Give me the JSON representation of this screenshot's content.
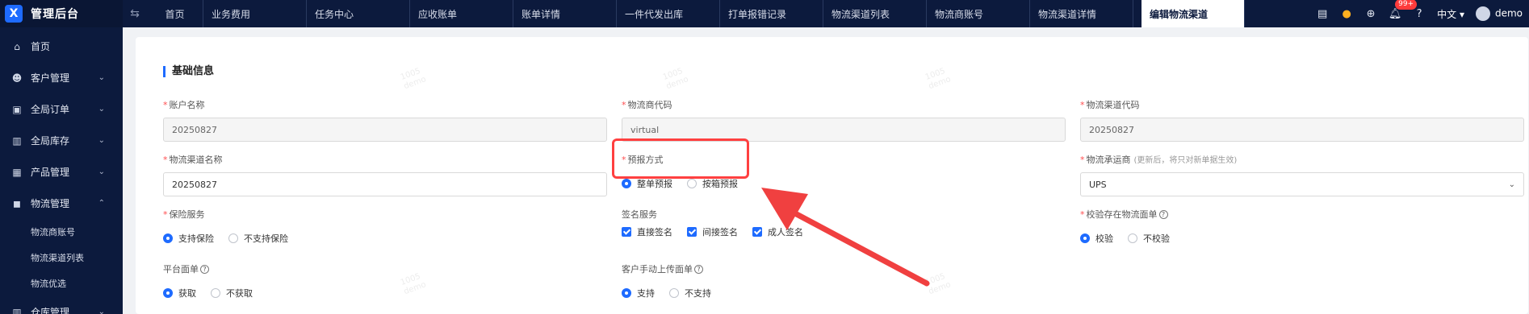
{
  "app": {
    "title": "管理后台",
    "logo_text": "X"
  },
  "tabs": [
    "首页",
    "业务费用",
    "任务中心",
    "应收账单",
    "账单详情",
    "一件代发出库",
    "打单报错记录",
    "物流渠道列表",
    "物流商账号",
    "物流渠道详情"
  ],
  "active_tab": "编辑物流渠道",
  "header_tools": {
    "notification_badge": "99+",
    "language": "中文",
    "user": "demo"
  },
  "sidebar": {
    "items": [
      {
        "label": "首页",
        "icon": "home-icon"
      },
      {
        "label": "客户管理",
        "icon": "users-icon"
      },
      {
        "label": "全局订单",
        "icon": "clipboard-icon"
      },
      {
        "label": "全局库存",
        "icon": "warehouse-icon"
      },
      {
        "label": "产品管理",
        "icon": "box-icon"
      },
      {
        "label": "物流管理",
        "icon": "truck-icon"
      }
    ],
    "sub_items": [
      "物流商账号",
      "物流渠道列表",
      "物流优选"
    ],
    "last_item": "仓库管理"
  },
  "form": {
    "section_title": "基础信息",
    "account_name": {
      "label": "账户名称",
      "value": "20250827"
    },
    "provider_code": {
      "label": "物流商代码",
      "value": "virtual"
    },
    "channel_code": {
      "label": "物流渠道代码",
      "value": "20250827"
    },
    "channel_name": {
      "label": "物流渠道名称",
      "value": "20250827"
    },
    "forecast_mode": {
      "label": "预报方式",
      "options": [
        "整单预报",
        "按箱预报"
      ],
      "selected": "整单预报"
    },
    "carrier": {
      "label": "物流承运商",
      "hint": "(更新后，将只对新单据生效)",
      "value": "UPS"
    },
    "insurance": {
      "label": "保险服务",
      "options": [
        "支持保险",
        "不支持保险"
      ],
      "selected": "支持保险"
    },
    "signature": {
      "label": "签名服务",
      "options": [
        "直接签名",
        "间接签名",
        "成人签名"
      ]
    },
    "verify_label": {
      "label": "校验存在物流面单",
      "options": [
        "校验",
        "不校验"
      ],
      "selected": "校验"
    },
    "platform_label": {
      "label": "平台面单",
      "options": [
        "获取",
        "不获取"
      ],
      "selected": "获取"
    },
    "manual_upload": {
      "label": "客户手动上传面单",
      "options": [
        "支持",
        "不支持"
      ],
      "selected": "支持"
    }
  },
  "watermark": {
    "line1": "1005",
    "line2": "demo"
  }
}
